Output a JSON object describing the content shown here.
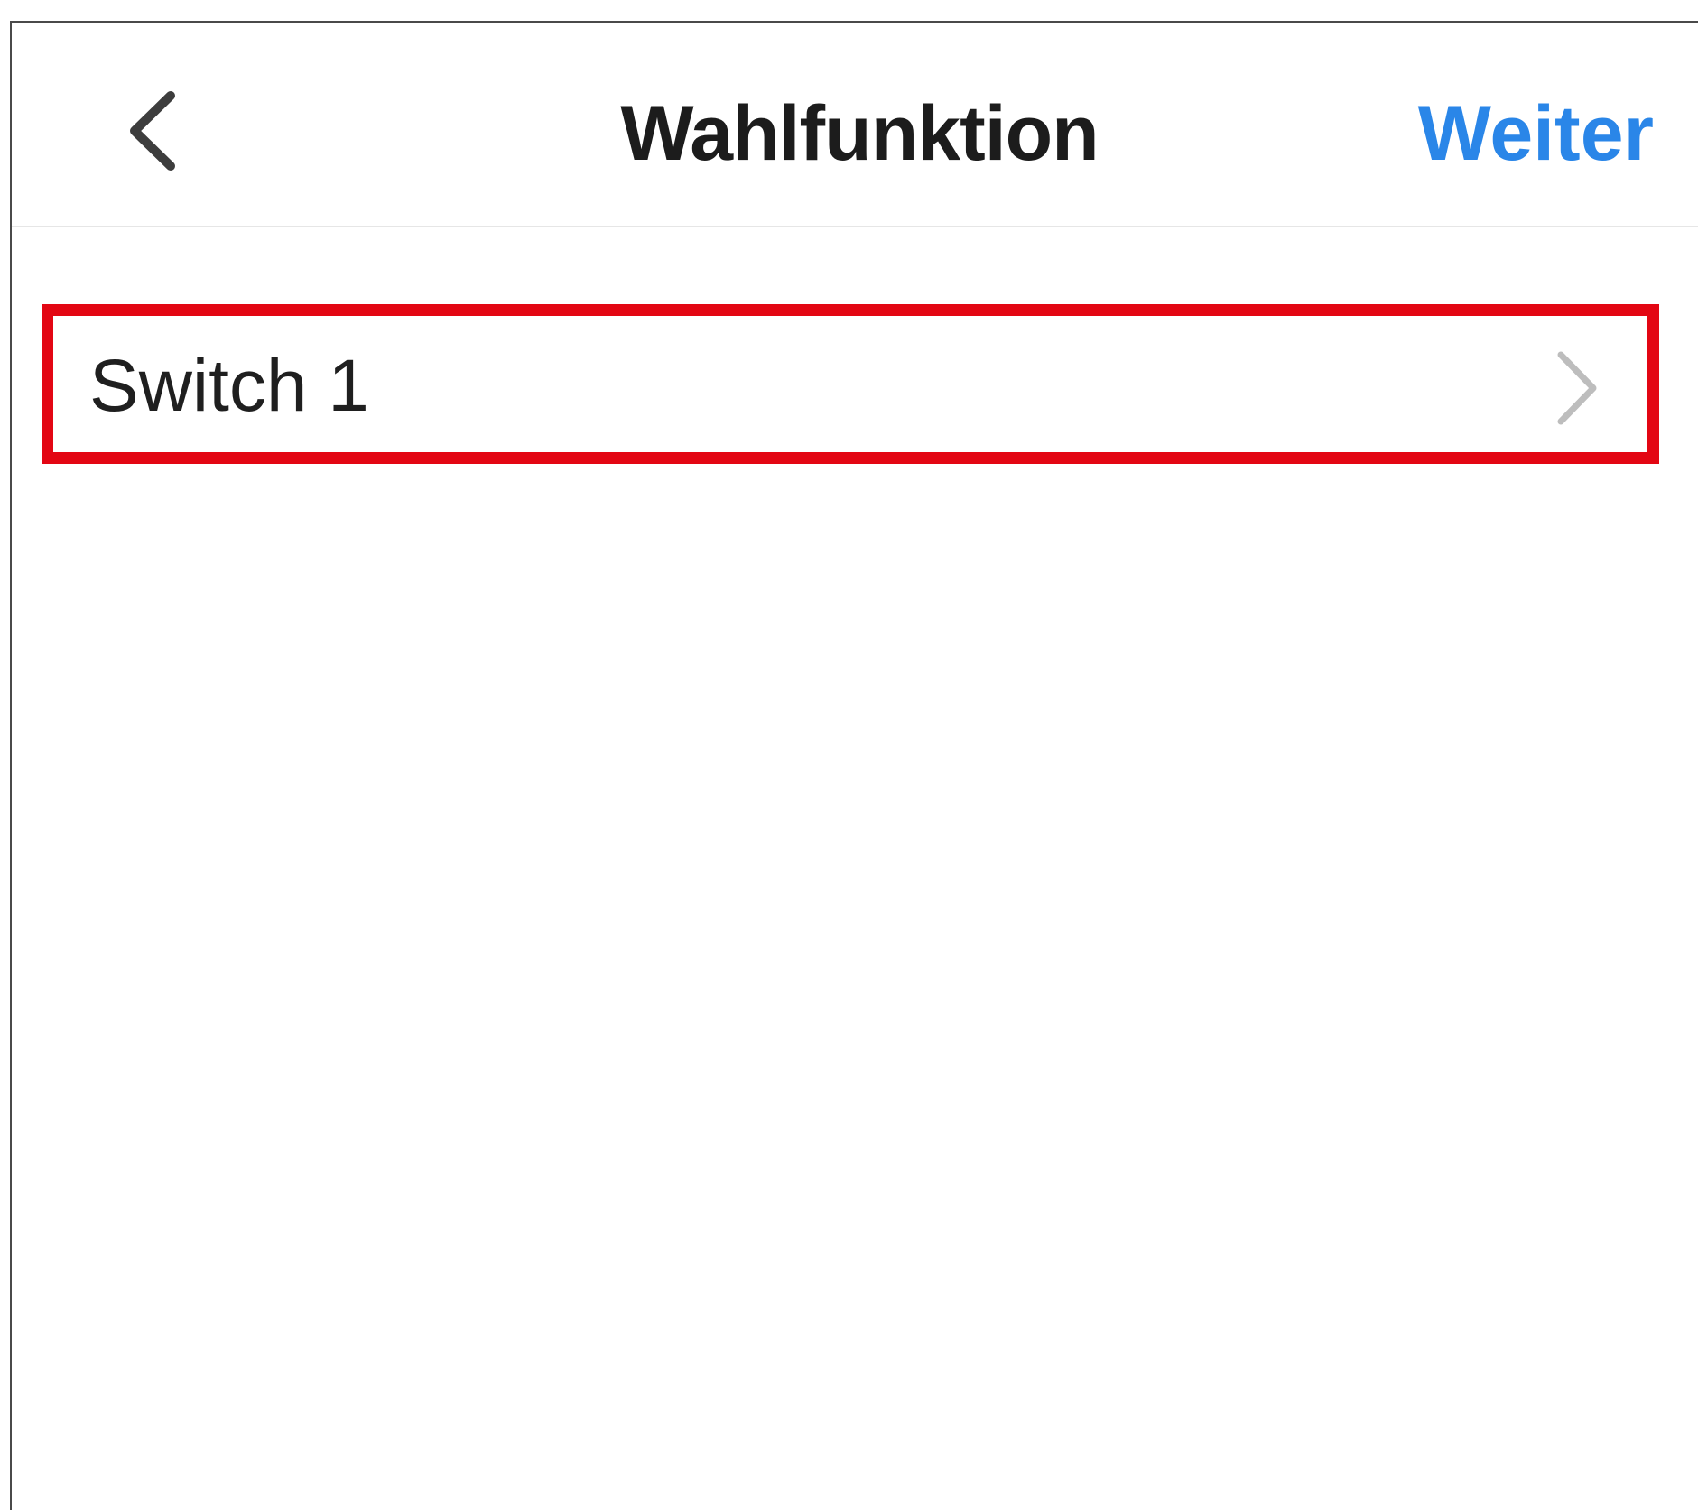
{
  "colors": {
    "accent": "#2a86e8",
    "highlight": "#e30613",
    "chevron": "#bdbdbd"
  },
  "header": {
    "back_icon": "chevron-left-icon",
    "title": "Wahlfunktion",
    "next_label": "Weiter"
  },
  "list": {
    "items": [
      {
        "label": "Switch 1",
        "icon": "chevron-right-icon"
      }
    ]
  }
}
